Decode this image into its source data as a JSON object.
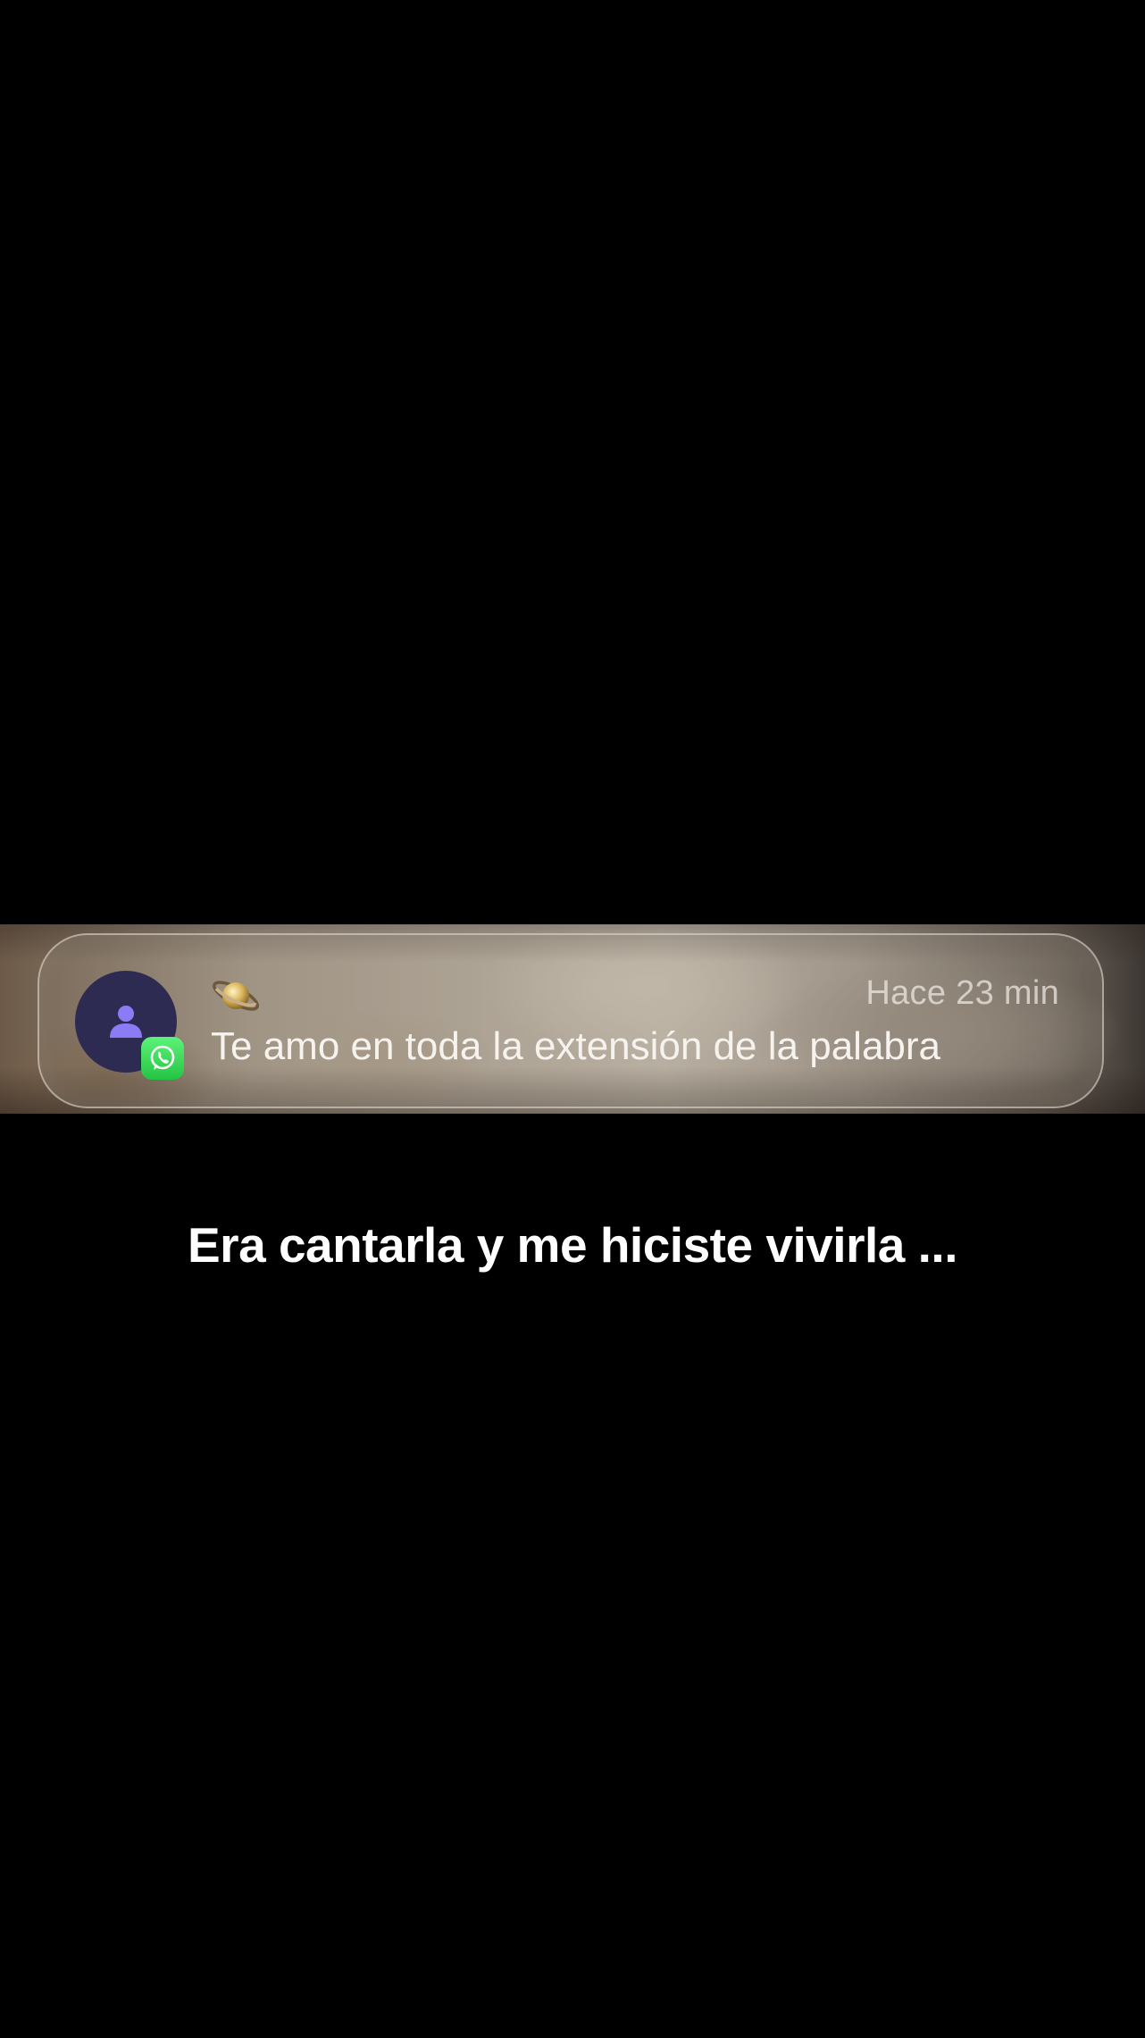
{
  "notification": {
    "emoji": "🪐",
    "timestamp": "Hace 23 min",
    "message": "Te amo en toda la extensión de la palabra",
    "app_icon": "whatsapp-icon",
    "avatar_icon": "person-icon"
  },
  "caption": {
    "text": "Era cantarla y me hiciste vivirla ..."
  },
  "colors": {
    "background": "#000000",
    "avatar_bg": "#2e2b52",
    "avatar_glyph": "#8b7cf6",
    "whatsapp_green": "#25c443"
  }
}
